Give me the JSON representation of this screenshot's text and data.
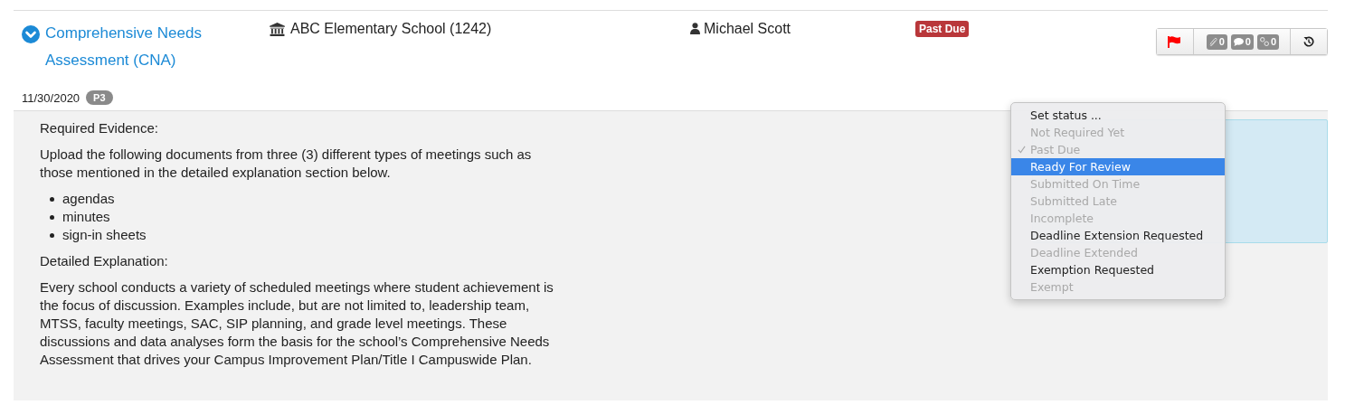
{
  "task": {
    "title": "Comprehensive Needs Assessment (CNA)",
    "expanded": true,
    "school": "ABC Elementary School (1242)",
    "assignee": "Michael Scott",
    "status_badge": "Past Due",
    "date": "11/30/2020",
    "priority": "P3"
  },
  "toolbar": {
    "flagged": true,
    "counters": [
      {
        "kind": "attachment",
        "count": "0"
      },
      {
        "kind": "comment",
        "count": "0"
      },
      {
        "kind": "link",
        "count": "0"
      }
    ]
  },
  "details": {
    "evidence_heading": "Required Evidence:",
    "evidence_text": "Upload the following documents from three (3) different types of meetings such as those mentioned in the detailed explanation section below.",
    "evidence_items": [
      "agendas",
      "minutes",
      "sign-in sheets"
    ],
    "explanation_heading": "Detailed Explanation:",
    "explanation_text": "Every school conducts a variety of scheduled meetings where student achievement is the focus of discussion. Examples include, but are not limited to, leadership team, MTSS, faculty meetings, SAC, SIP planning, and grade level meetings. These discussions and data analyses form the basis for the school’s Comprehensive Needs Assessment that drives your Campus Improvement Plan/Title I Campuswide Plan."
  },
  "status_menu": {
    "title": "Set status ...",
    "items": [
      {
        "label": "Not Required Yet",
        "disabled": true,
        "checked": false,
        "selected": false
      },
      {
        "label": "Past Due",
        "disabled": true,
        "checked": true,
        "selected": false
      },
      {
        "label": "Ready For Review",
        "disabled": false,
        "checked": false,
        "selected": true
      },
      {
        "label": "Submitted On Time",
        "disabled": true,
        "checked": false,
        "selected": false
      },
      {
        "label": "Submitted Late",
        "disabled": true,
        "checked": false,
        "selected": false
      },
      {
        "label": "Incomplete",
        "disabled": true,
        "checked": false,
        "selected": false
      },
      {
        "label": "Deadline Extension Requested",
        "disabled": false,
        "checked": false,
        "selected": false
      },
      {
        "label": "Deadline Extended",
        "disabled": true,
        "checked": false,
        "selected": false
      },
      {
        "label": "Exemption Requested",
        "disabled": false,
        "checked": false,
        "selected": false
      },
      {
        "label": "Exempt",
        "disabled": true,
        "checked": false,
        "selected": false
      }
    ]
  }
}
